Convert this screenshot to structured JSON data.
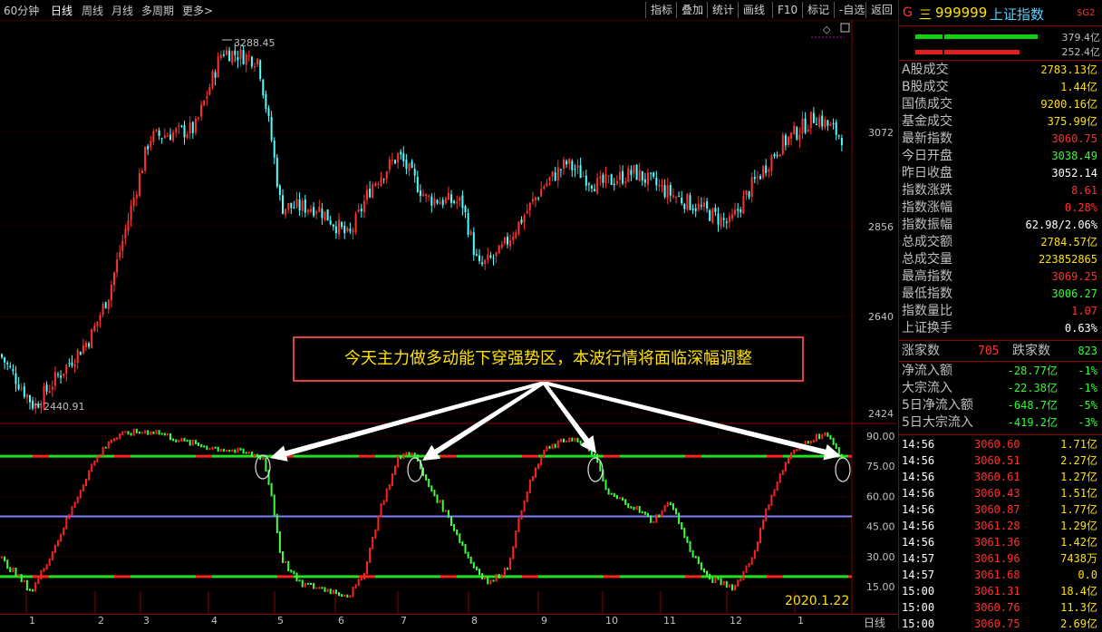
{
  "toolbar": {
    "tabs": [
      "60分钟",
      "日线",
      "周线",
      "月线",
      "多周期",
      "更多>"
    ],
    "active_tab": "日线",
    "buttons": [
      "指标",
      "叠加",
      "统计",
      "画线",
      "F10",
      "标记",
      "-自选",
      "返回"
    ]
  },
  "chart": {
    "price_axis": [
      "3072",
      "2856",
      "2640",
      "2424"
    ],
    "osc_axis": [
      "90.00",
      "75.00",
      "60.00",
      "45.00",
      "30.00",
      "15.00"
    ],
    "high_label": "3288.45",
    "low_label": "2440.91",
    "annotation": "今天主力做多动能下穿强势区，本波行情将面临深幅调整",
    "date_label": "2020.1.22",
    "month_ticks": [
      "1",
      "2",
      "3",
      "4",
      "5",
      "6",
      "7",
      "8",
      "9",
      "10",
      "11",
      "12",
      "1"
    ],
    "period_label": "日线",
    "colors": {
      "up": "#ff3232",
      "down": "#54ffff",
      "osc_up": "#ff2020",
      "osc_down": "#40ff40",
      "mid_line": "#8080ff"
    }
  },
  "quote": {
    "code_prefix": "G",
    "code_menu": "三",
    "code": "999999",
    "name": "上证指数",
    "badge": "$G2",
    "bar_values": [
      "379.4亿",
      "252.4亿"
    ],
    "rows": [
      {
        "label": "A股成交",
        "value": "2783.13亿",
        "color": "#ffe000"
      },
      {
        "label": "B股成交",
        "value": "1.44亿",
        "color": "#ffe000"
      },
      {
        "label": "国债成交",
        "value": "9200.16亿",
        "color": "#ffe000"
      },
      {
        "label": "基金成交",
        "value": "375.99亿",
        "color": "#ffe000"
      },
      {
        "label": "最新指数",
        "value": "3060.75",
        "color": "#ff3030"
      },
      {
        "label": "今日开盘",
        "value": "3038.49",
        "color": "#30ff30"
      },
      {
        "label": "昨日收盘",
        "value": "3052.14",
        "color": "#ffffff"
      },
      {
        "label": "指数涨跌",
        "value": "8.61",
        "color": "#ff3030"
      },
      {
        "label": "指数涨幅",
        "value": "0.28%",
        "color": "#ff3030"
      },
      {
        "label": "指数振幅",
        "value": "62.98/2.06%",
        "color": "#ffffff"
      },
      {
        "label": "总成交额",
        "value": "2784.57亿",
        "color": "#ffe000"
      },
      {
        "label": "总成交量",
        "value": "223852865",
        "color": "#ffe000"
      },
      {
        "label": "最高指数",
        "value": "3069.25",
        "color": "#ff3030"
      },
      {
        "label": "最低指数",
        "value": "3006.27",
        "color": "#30ff30"
      },
      {
        "label": "指数量比",
        "value": "1.07",
        "color": "#ff3030"
      },
      {
        "label": "上证换手",
        "value": "0.63%",
        "color": "#ffffff"
      }
    ],
    "up_label": "涨家数",
    "up_count": "705",
    "down_label": "跌家数",
    "down_count": "823",
    "flows": [
      {
        "label": "净流入额",
        "value": "-28.77亿",
        "pct": "-1%"
      },
      {
        "label": "大宗流入",
        "value": "-22.38亿",
        "pct": "-1%"
      },
      {
        "label": "5日净流入额",
        "value": "-648.7亿",
        "pct": "-5%"
      },
      {
        "label": "5日大宗流入",
        "value": "-419.2亿",
        "pct": "-3%"
      }
    ],
    "ticks": [
      {
        "time": "14:56",
        "price": "3060.60",
        "vol": "1.71亿"
      },
      {
        "time": "14:56",
        "price": "3060.51",
        "vol": "2.27亿"
      },
      {
        "time": "14:56",
        "price": "3060.61",
        "vol": "1.27亿"
      },
      {
        "time": "14:56",
        "price": "3060.43",
        "vol": "1.51亿"
      },
      {
        "time": "14:56",
        "price": "3060.87",
        "vol": "1.77亿"
      },
      {
        "time": "14:56",
        "price": "3061.28",
        "vol": "1.29亿"
      },
      {
        "time": "14:56",
        "price": "3061.36",
        "vol": "1.42亿"
      },
      {
        "time": "14:57",
        "price": "3061.96",
        "vol": "7438万"
      },
      {
        "time": "14:57",
        "price": "3061.68",
        "vol": "0.0"
      },
      {
        "time": "15:00",
        "price": "3061.31",
        "vol": "18.4亿"
      },
      {
        "time": "15:00",
        "price": "3060.76",
        "vol": "11.3亿"
      },
      {
        "time": "15:00",
        "price": "3060.75",
        "vol": "2.69亿"
      }
    ]
  }
}
